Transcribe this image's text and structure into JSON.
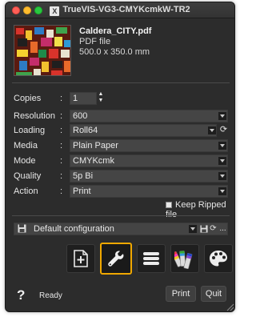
{
  "window": {
    "title": "TrueVIS-VG3-CMYKcmkW-TR2",
    "app_icon_glyph": "X"
  },
  "file": {
    "name": "Caldera_CITY.pdf",
    "type": "PDF file",
    "size": "500.0 x 350.0 mm"
  },
  "settings": {
    "copies": {
      "label": "Copies",
      "value": "1"
    },
    "resolution": {
      "label": "Resolution",
      "value": "600"
    },
    "loading": {
      "label": "Loading",
      "value": "Roll64"
    },
    "media": {
      "label": "Media",
      "value": "Plain Paper"
    },
    "mode": {
      "label": "Mode",
      "value": "CMYKcmk"
    },
    "quality": {
      "label": "Quality",
      "value": "5p Bi"
    },
    "action": {
      "label": "Action",
      "value": "Print"
    },
    "colon": ":"
  },
  "keep_ripped": {
    "label": "Keep Ripped file",
    "checked": false
  },
  "configuration": {
    "value": "Default configuration",
    "more_label": "..."
  },
  "toolbar": {
    "buttons": [
      {
        "icon": "add-page-icon",
        "active": false
      },
      {
        "icon": "wrench-icon",
        "active": true
      },
      {
        "icon": "list-icon",
        "active": false
      },
      {
        "icon": "color-swatches-icon",
        "active": false
      },
      {
        "icon": "palette-icon",
        "active": false
      }
    ],
    "accent_color": "#f0a800"
  },
  "bottom": {
    "help": "?",
    "status": "Ready",
    "print_label": "Print",
    "quit_label": "Quit"
  }
}
